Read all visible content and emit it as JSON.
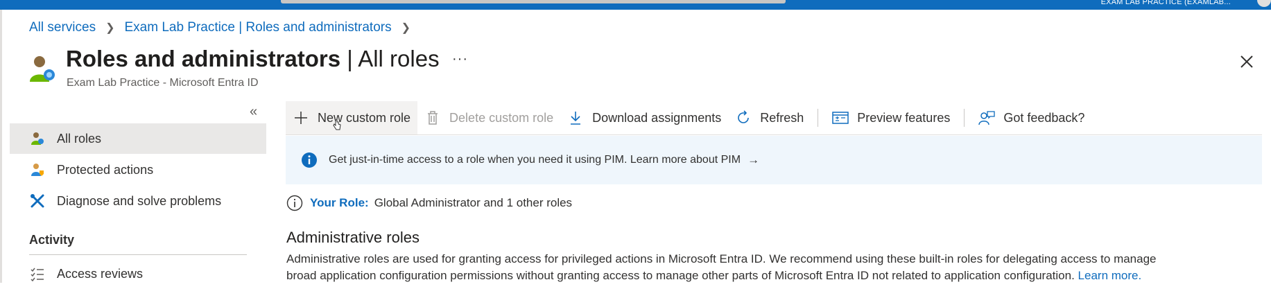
{
  "topbar": {
    "account_label": "EXAM LAB PRACTICE (EXAMLAB..."
  },
  "breadcrumb": {
    "items": [
      "All services",
      "Exam Lab Practice | Roles and administrators"
    ]
  },
  "header": {
    "title_bold": "Roles and administrators",
    "title_rest": " | All roles",
    "more_label": "···",
    "subtitle": "Exam Lab Practice - Microsoft Entra ID",
    "close_icon": "close-icon"
  },
  "sidebar": {
    "collapse_label": "«",
    "items": [
      {
        "label": "All roles",
        "icon": "roles-user-icon",
        "active": true
      },
      {
        "label": "Protected actions",
        "icon": "protected-user-icon",
        "active": false
      },
      {
        "label": "Diagnose and solve problems",
        "icon": "tools-icon",
        "active": false
      }
    ],
    "section_label": "Activity",
    "activity_items": [
      {
        "label": "Access reviews",
        "icon": "checklist-icon"
      }
    ]
  },
  "toolbar": {
    "new_custom_role": "New custom role",
    "delete_custom_role": "Delete custom role",
    "download_assignments": "Download assignments",
    "refresh": "Refresh",
    "preview_features": "Preview features",
    "got_feedback": "Got feedback?"
  },
  "banner": {
    "text": "Get just-in-time access to a role when you need it using PIM. Learn more about PIM",
    "arrow": "→"
  },
  "your_role": {
    "label": "Your Role:",
    "value": "Global Administrator and 1 other roles"
  },
  "admin_roles": {
    "title": "Administrative roles",
    "description_line1": "Administrative roles are used for granting access for privileged actions in Microsoft Entra ID. We recommend using these built-in roles for delegating access to manage",
    "description_line2": "broad application configuration permissions without granting access to manage other parts of Microsoft Entra ID not related to application configuration.",
    "learn_more": "Learn more."
  },
  "colors": {
    "brand": "#0f6cbd",
    "banner_bg": "#eff6fc",
    "active_nav": "#e9e8e7"
  }
}
